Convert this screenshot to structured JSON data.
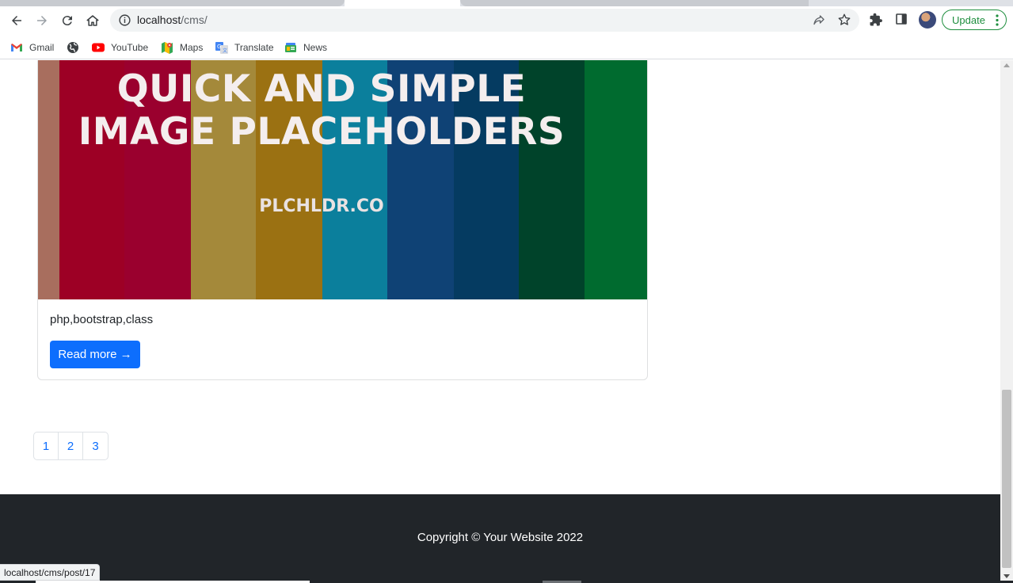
{
  "browser": {
    "url_host": "localhost",
    "url_path": "/cms/",
    "update_label": "Update",
    "bookmarks": [
      {
        "label": "Gmail",
        "icon": "gmail-icon"
      },
      {
        "label": "",
        "icon": "globe-icon"
      },
      {
        "label": "YouTube",
        "icon": "youtube-icon"
      },
      {
        "label": "Maps",
        "icon": "maps-icon"
      },
      {
        "label": "Translate",
        "icon": "translate-icon"
      },
      {
        "label": "News",
        "icon": "news-icon"
      }
    ],
    "status_url": "localhost/cms/post/17"
  },
  "post_card": {
    "image_headline_line1": "QUICK AND SIMPLE",
    "image_headline_line2": "IMAGE PLACEHOLDERS",
    "image_brand": "PLCHLDR.CO",
    "image_stripe_colors": [
      "#a86e5e",
      "#9d0025",
      "#9a002e",
      "#a4893a",
      "#9b7112",
      "#0b7f9c",
      "#0f4275",
      "#053b61",
      "#00432a",
      "#006b2f"
    ],
    "tags": "php,bootstrap,class",
    "read_more_label": "Read more →"
  },
  "pagination": {
    "pages": [
      "1",
      "2",
      "3"
    ]
  },
  "footer": {
    "copyright": "Copyright © Your Website 2022"
  },
  "colors": {
    "primary": "#0d6efd",
    "footer_bg": "#212529",
    "update_green": "#1e8e3e"
  }
}
